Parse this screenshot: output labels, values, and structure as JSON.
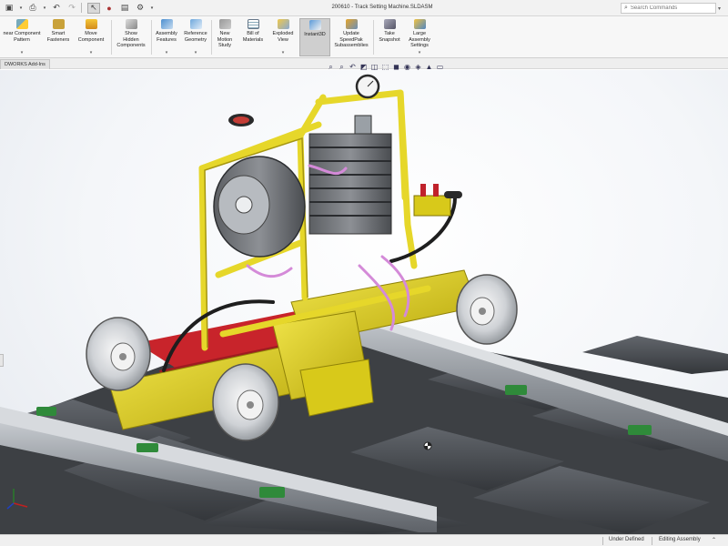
{
  "window": {
    "document_title": "200610 - Track Setting Machine.SLDASM",
    "search_placeholder": "Search Commands"
  },
  "ribbon": {
    "buttons": [
      {
        "label": "near Component\nPattern",
        "icon": "pattern-icon"
      },
      {
        "label": "Smart\nFasteners",
        "icon": "fastener-icon"
      },
      {
        "label": "Move\nComponent",
        "icon": "move-component-icon"
      },
      {
        "label": "Show\nHidden\nComponents",
        "icon": "show-hidden-icon"
      },
      {
        "label": "Assembly\nFeatures",
        "icon": "assembly-features-icon"
      },
      {
        "label": "Reference\nGeometry",
        "icon": "reference-geometry-icon"
      },
      {
        "label": "New\nMotion\nStudy",
        "icon": "motion-study-icon"
      },
      {
        "label": "Bill of\nMaterials",
        "icon": "bom-icon"
      },
      {
        "label": "Exploded\nView",
        "icon": "exploded-view-icon"
      },
      {
        "label": "Instant3D",
        "icon": "instant3d-icon"
      },
      {
        "label": "Update\nSpeedPak\nSubassemblies",
        "icon": "speedpak-icon"
      },
      {
        "label": "Take\nSnapshot",
        "icon": "snapshot-icon"
      },
      {
        "label": "Large\nAssembly\nSettings",
        "icon": "large-assembly-icon"
      }
    ]
  },
  "tabs": {
    "addin_tab": "DWORKS Add-Ins"
  },
  "status": {
    "definition": "Under Defined",
    "mode": "Editing Assembly"
  },
  "colors": {
    "frame_yellow": "#e2d31a",
    "chassis_red": "#c8242b",
    "rail_steel": "#9a9ea3",
    "sleeper_dark": "#4a4d52",
    "ballast": "#3e4145",
    "active_button": "#cfcfcf",
    "clip_green": "#2f8a3a"
  }
}
